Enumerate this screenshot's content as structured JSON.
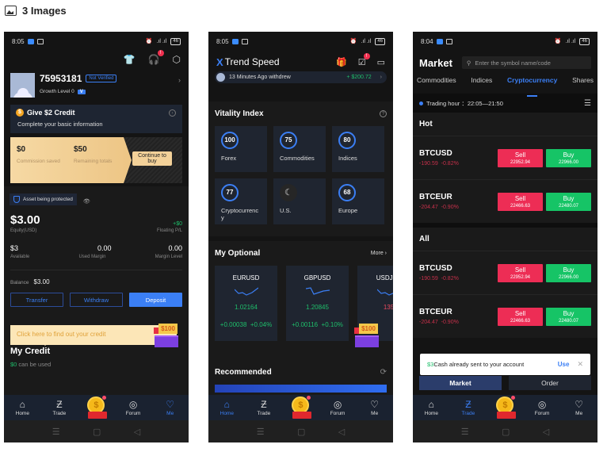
{
  "header": {
    "icon": "image-gallery-icon",
    "title": "3 Images"
  },
  "phone1": {
    "status": {
      "time": "8:05",
      "battery": "46"
    },
    "user_id": "75953181",
    "verify_badge": "Not Verified",
    "growth_label": "Growth Level 0",
    "growth_badge": "V",
    "credit_card": {
      "title": "Give $2 Credit",
      "subtitle": "Complete your basic information"
    },
    "commission": {
      "saved_value": "$0",
      "saved_label": "Commission saved",
      "remaining_value": "$50",
      "remaining_label": "Remaining totals",
      "continue_label": "Continue to buy"
    },
    "asset_protect": "Asset being protected",
    "equity": {
      "value": "$3.00",
      "label": "Equity(USD)"
    },
    "floating": {
      "value": "+$0",
      "label": "Floating P/L"
    },
    "available": {
      "value": "$3",
      "label": "Available"
    },
    "used_margin": {
      "value": "0.00",
      "label": "Used Margin"
    },
    "margin_level": {
      "value": "0.00",
      "label": "Margin Level"
    },
    "balance": {
      "label": "Balance",
      "value": "$3.00"
    },
    "buttons": {
      "transfer": "Transfer",
      "withdraw": "Withdraw",
      "deposit": "Deposit"
    },
    "tooltip": "Click here to find out your credit",
    "gift_amount": "$100",
    "my_credit": {
      "title": "My Credit",
      "amount": "$0",
      "suffix": " can be used"
    },
    "active_tab": "Me"
  },
  "phone2": {
    "status": {
      "time": "8:05",
      "battery": "46"
    },
    "logo_mark": "X",
    "logo_text": "Trend Speed",
    "ticker": {
      "text": "13 Minutes Ago withdrew",
      "amount": "+ $200.72"
    },
    "vitality": {
      "title": "Vitality Index",
      "items": [
        {
          "value": "100",
          "label": "Forex"
        },
        {
          "value": "75",
          "label": "Commodities"
        },
        {
          "value": "80",
          "label": "Indices"
        },
        {
          "value": "77",
          "label": "Cryptocurrency"
        },
        {
          "value": "",
          "label": "U.S."
        },
        {
          "value": "68",
          "label": "Europe"
        }
      ]
    },
    "optional": {
      "title": "My Optional",
      "more": "More",
      "items": [
        {
          "symbol": "EURUSD",
          "price": "1.02164",
          "change": "+0.00038",
          "pct": "+0.04%"
        },
        {
          "symbol": "GBPUSD",
          "price": "1.20845",
          "change": "+0.00116",
          "pct": "+0.10%"
        },
        {
          "symbol": "USDJPY",
          "price": "135",
          "change": "",
          "pct": ""
        }
      ]
    },
    "recommended": "Recommended",
    "gift_amount": "$100",
    "active_tab": "Home"
  },
  "phone3": {
    "status": {
      "time": "8:04",
      "battery": "46"
    },
    "title": "Market",
    "search_placeholder": "Enter the symbol name/code",
    "tabs": [
      "Commodities",
      "Indices",
      "Cryptocurrency",
      "Shares"
    ],
    "active_tab_index": 2,
    "trading_hour": "Trading hour ：22:05—21:50",
    "hot_title": "Hot",
    "all_title": "All",
    "hot": [
      {
        "symbol": "BTCUSD",
        "change": "-190.59",
        "pct": "-0.82%",
        "sell": "22952.94",
        "buy": "22966.00"
      },
      {
        "symbol": "BTCEUR",
        "change": "-204.47",
        "pct": "-0.90%",
        "sell": "22466.63",
        "buy": "22480.07"
      }
    ],
    "all": [
      {
        "symbol": "BTCUSD",
        "change": "-190.59",
        "pct": "-0.82%",
        "sell": "22952.94",
        "buy": "22966.00"
      },
      {
        "symbol": "BTCEUR",
        "change": "-204.47",
        "pct": "-0.90%",
        "sell": "22466.63",
        "buy": "22480.07"
      }
    ],
    "sell_label": "Sell",
    "buy_label": "Buy",
    "toast": {
      "amount": "$3",
      "text": "Cash already sent to your account",
      "action": "Use"
    },
    "bottom_tabs": {
      "market": "Market",
      "order": "Order"
    },
    "active_tab": "Trade"
  },
  "nav": {
    "home": "Home",
    "trade": "Trade",
    "forum": "Forum",
    "me": "Me"
  },
  "colors": {
    "accent": "#3b7ff5",
    "sell": "#ed2d55",
    "buy": "#16c466",
    "positive": "#1fbf6b",
    "negative": "#c5304a"
  }
}
